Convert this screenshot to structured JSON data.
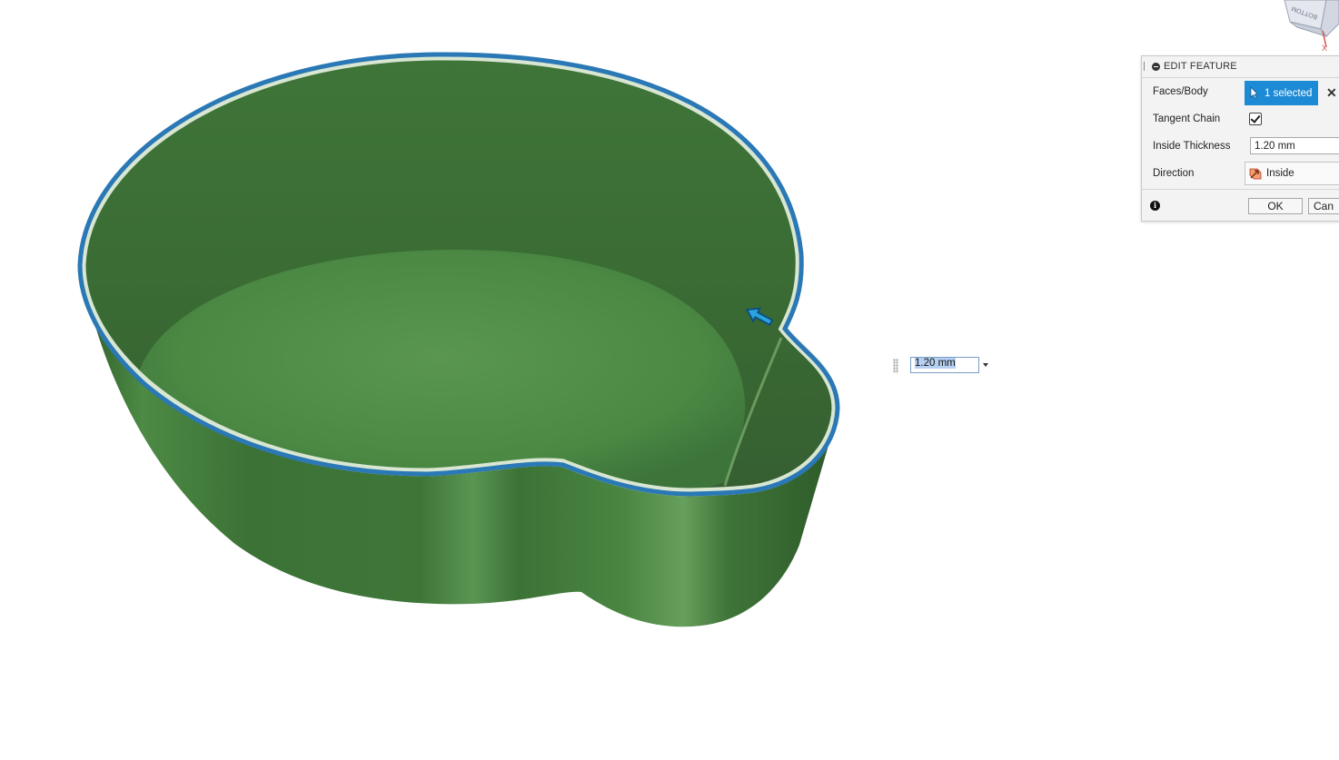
{
  "panel": {
    "title": "EDIT FEATURE",
    "faces_label": "Faces/Body",
    "faces_value": "1 selected",
    "clear_symbol": "✕",
    "tangent_label": "Tangent Chain",
    "tangent_checked": true,
    "thickness_label": "Inside Thickness",
    "thickness_value": "1.20 mm",
    "direction_label": "Direction",
    "direction_value": "Inside",
    "info_symbol": "i",
    "ok_label": "OK",
    "cancel_label": "Can"
  },
  "manipulator": {
    "value": "1.20 mm"
  },
  "viewcube": {
    "face_label": "BOTTOM",
    "axis_label": "X"
  },
  "colors": {
    "shell_green": "#3f7a3a",
    "edge_blue": "#2a78b5",
    "selection_blue": "#1d8ad6"
  },
  "icons": {
    "selection": "cursor-arrow-icon",
    "direction": "direction-inside-icon",
    "info": "info-icon",
    "manipulator": "thickness-arrow-icon"
  }
}
